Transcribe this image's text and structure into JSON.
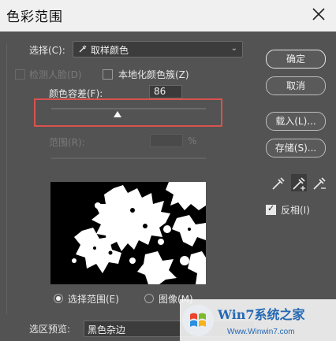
{
  "dialog": {
    "title": "色彩范围"
  },
  "select_row": {
    "label": "选择(C):",
    "value": "取样颜色"
  },
  "options": {
    "detect_faces": "检测人脸(D)",
    "localized_clusters": "本地化颜色簇(Z)",
    "localized_checked": false
  },
  "fuzziness": {
    "label": "颜色容差(F):",
    "value": "86",
    "level": 0.42
  },
  "range": {
    "label": "范围(R):",
    "unit": "%",
    "value": ""
  },
  "preview_mode": {
    "selection": "选择范围(E)",
    "image": "图像(M)",
    "selected": "selection"
  },
  "selection_preview": {
    "label": "选区预览:",
    "value": "黑色杂边"
  },
  "buttons": {
    "ok": "确定",
    "cancel": "取消",
    "load": "载入(L)...",
    "save": "存储(S)..."
  },
  "eyedroppers": [
    "eyedropper-icon",
    "eyedropper-plus-icon",
    "eyedropper-minus-icon"
  ],
  "invert": {
    "label": "反相(I)",
    "checked": true
  },
  "watermark": {
    "brand": "Win7系统之家",
    "url": "Www.Winwin7.com"
  },
  "colors": {
    "dialog_bg": "#535353",
    "title_bg": "#f0f0f0",
    "highlight": "#d9534f"
  }
}
